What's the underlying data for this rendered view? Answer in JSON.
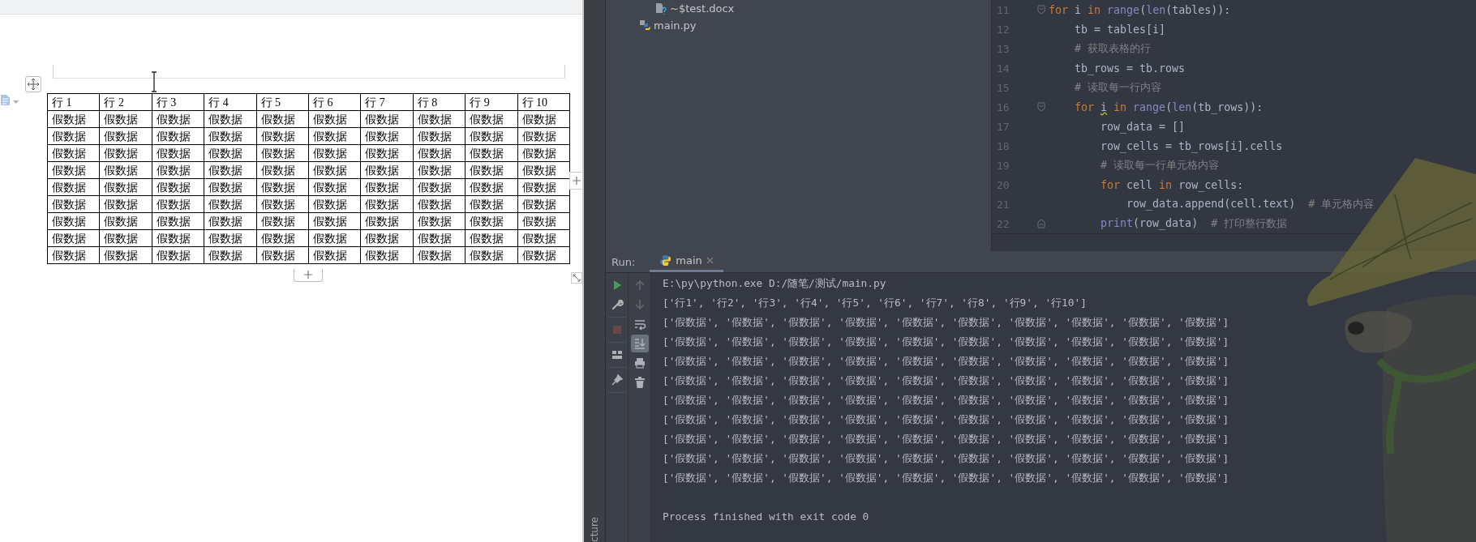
{
  "document": {
    "table": {
      "header": [
        "行 1",
        "行 2",
        "行 3",
        "行 4",
        "行 5",
        "行 6",
        "行 7",
        "行 8",
        "行 9",
        "行 10"
      ],
      "rows": [
        [
          "假数据",
          "假数据",
          "假数据",
          "假数据",
          "假数据",
          "假数据",
          "假数据",
          "假数据",
          "假数据",
          "假数据"
        ],
        [
          "假数据",
          "假数据",
          "假数据",
          "假数据",
          "假数据",
          "假数据",
          "假数据",
          "假数据",
          "假数据",
          "假数据"
        ],
        [
          "假数据",
          "假数据",
          "假数据",
          "假数据",
          "假数据",
          "假数据",
          "假数据",
          "假数据",
          "假数据",
          "假数据"
        ],
        [
          "假数据",
          "假数据",
          "假数据",
          "假数据",
          "假数据",
          "假数据",
          "假数据",
          "假数据",
          "假数据",
          "假数据"
        ],
        [
          "假数据",
          "假数据",
          "假数据",
          "假数据",
          "假数据",
          "假数据",
          "假数据",
          "假数据",
          "假数据",
          "假数据"
        ],
        [
          "假数据",
          "假数据",
          "假数据",
          "假数据",
          "假数据",
          "假数据",
          "假数据",
          "假数据",
          "假数据",
          "假数据"
        ],
        [
          "假数据",
          "假数据",
          "假数据",
          "假数据",
          "假数据",
          "假数据",
          "假数据",
          "假数据",
          "假数据",
          "假数据"
        ],
        [
          "假数据",
          "假数据",
          "假数据",
          "假数据",
          "假数据",
          "假数据",
          "假数据",
          "假数据",
          "假数据",
          "假数据"
        ],
        [
          "假数据",
          "假数据",
          "假数据",
          "假数据",
          "假数据",
          "假数据",
          "假数据",
          "假数据",
          "假数据",
          "假数据"
        ]
      ]
    }
  },
  "ide": {
    "side_strip": {
      "label": "cture"
    },
    "project_tree": {
      "items": [
        {
          "children": [
            {
              "label": "~$test.docx",
              "kind": "unknown"
            }
          ]
        },
        {
          "label": "main.py",
          "kind": "python"
        }
      ]
    },
    "editor": {
      "lines": [
        {
          "number": "11",
          "kind": "fold-start",
          "tokens": [
            {
              "kind": "keyword",
              "text": "for"
            },
            {
              "kind": "plain",
              "text": " i "
            },
            {
              "kind": "keyword",
              "text": "in"
            },
            {
              "kind": "builtin",
              "text": " range"
            },
            {
              "kind": "plain",
              "text": "("
            },
            {
              "kind": "builtin",
              "text": "len"
            },
            {
              "kind": "plain",
              "text": "(tables)):"
            }
          ]
        },
        {
          "number": "12",
          "kind": "plain",
          "tokens": [
            {
              "kind": "plain",
              "text": "    tb = tables[i]"
            }
          ]
        },
        {
          "number": "13",
          "kind": "plain",
          "tokens": [
            {
              "kind": "comment",
              "text": "    # 获取表格的行"
            }
          ]
        },
        {
          "number": "14",
          "kind": "plain",
          "tokens": [
            {
              "kind": "plain",
              "text": "    tb_rows = tb.rows"
            }
          ]
        },
        {
          "number": "15",
          "kind": "plain",
          "tokens": [
            {
              "kind": "comment",
              "text": "    # 读取每一行内容"
            }
          ]
        },
        {
          "number": "16",
          "kind": "fold-start",
          "tokens": [
            {
              "kind": "keyword",
              "text": "    for "
            },
            {
              "kind": "warning",
              "text": "i"
            },
            {
              "kind": "keyword",
              "text": " in"
            },
            {
              "kind": "builtin",
              "text": " range"
            },
            {
              "kind": "plain",
              "text": "("
            },
            {
              "kind": "builtin",
              "text": "len"
            },
            {
              "kind": "plain",
              "text": "(tb_rows)):"
            }
          ]
        },
        {
          "number": "17",
          "kind": "plain",
          "tokens": [
            {
              "kind": "plain",
              "text": "        row_data = []"
            }
          ]
        },
        {
          "number": "18",
          "kind": "plain",
          "tokens": [
            {
              "kind": "plain",
              "text": "        row_cells = tb_rows[i].cells"
            }
          ]
        },
        {
          "number": "19",
          "kind": "plain",
          "tokens": [
            {
              "kind": "comment",
              "text": "        # 读取每一行单元格内容"
            }
          ]
        },
        {
          "number": "20",
          "kind": "plain",
          "tokens": [
            {
              "kind": "keyword",
              "text": "        for"
            },
            {
              "kind": "plain",
              "text": " cell "
            },
            {
              "kind": "keyword",
              "text": "in"
            },
            {
              "kind": "plain",
              "text": " row_cells:"
            }
          ]
        },
        {
          "number": "21",
          "kind": "plain",
          "tokens": [
            {
              "kind": "plain",
              "text": "            row_data.append(cell.text)  "
            },
            {
              "kind": "comment",
              "text": "# 单元格内容"
            }
          ]
        },
        {
          "number": "22",
          "kind": "fold-end",
          "tokens": [
            {
              "kind": "builtin",
              "text": "        print"
            },
            {
              "kind": "plain",
              "text": "(row_data)  "
            },
            {
              "kind": "comment",
              "text": "# 打印整行数据"
            }
          ]
        }
      ]
    },
    "run_panel": {
      "label": "Run:",
      "tabs": [
        {
          "label": "main",
          "selected": true
        }
      ],
      "toolbar_1": {
        "groups": [
          {
            "buttons": [
              {
                "kind": "run",
                "disabled": false
              },
              {
                "kind": "settings",
                "disabled": false
              }
            ]
          },
          {
            "buttons": [
              {
                "kind": "stop",
                "disabled": true
              }
            ]
          },
          {
            "buttons": [
              {
                "kind": "layout",
                "disabled": false
              }
            ]
          },
          {
            "buttons": [
              {
                "kind": "pin",
                "disabled": false
              }
            ]
          }
        ]
      },
      "toolbar_2": {
        "buttons": [
          {
            "kind": "up",
            "disabled": true,
            "selected": false
          },
          {
            "kind": "down",
            "disabled": true,
            "selected": false
          },
          {
            "kind": "wrap",
            "disabled": false,
            "selected": false
          },
          {
            "kind": "scroll",
            "disabled": false,
            "selected": true
          },
          {
            "kind": "print",
            "disabled": false,
            "selected": false
          },
          {
            "kind": "trash",
            "disabled": false,
            "selected": false
          }
        ]
      },
      "output": [
        {
          "kind": "command",
          "text": "E:\\py\\python.exe D:/随笔/测试/main.py"
        },
        "['行1', '行2', '行3', '行4', '行5', '行6', '行7', '行8', '行9', '行10']",
        "['假数据', '假数据', '假数据', '假数据', '假数据', '假数据', '假数据', '假数据', '假数据', '假数据']",
        "['假数据', '假数据', '假数据', '假数据', '假数据', '假数据', '假数据', '假数据', '假数据', '假数据']",
        "['假数据', '假数据', '假数据', '假数据', '假数据', '假数据', '假数据', '假数据', '假数据', '假数据']",
        "['假数据', '假数据', '假数据', '假数据', '假数据', '假数据', '假数据', '假数据', '假数据', '假数据']",
        "['假数据', '假数据', '假数据', '假数据', '假数据', '假数据', '假数据', '假数据', '假数据', '假数据']",
        "['假数据', '假数据', '假数据', '假数据', '假数据', '假数据', '假数据', '假数据', '假数据', '假数据']",
        "['假数据', '假数据', '假数据', '假数据', '假数据', '假数据', '假数据', '假数据', '假数据', '假数据']",
        "['假数据', '假数据', '假数据', '假数据', '假数据', '假数据', '假数据', '假数据', '假数据', '假数据']",
        "['假数据', '假数据', '假数据', '假数据', '假数据', '假数据', '假数据', '假数据', '假数据', '假数据']",
        {
          "kind": "exit",
          "text": "Process finished with exit code 0"
        }
      ]
    }
  }
}
